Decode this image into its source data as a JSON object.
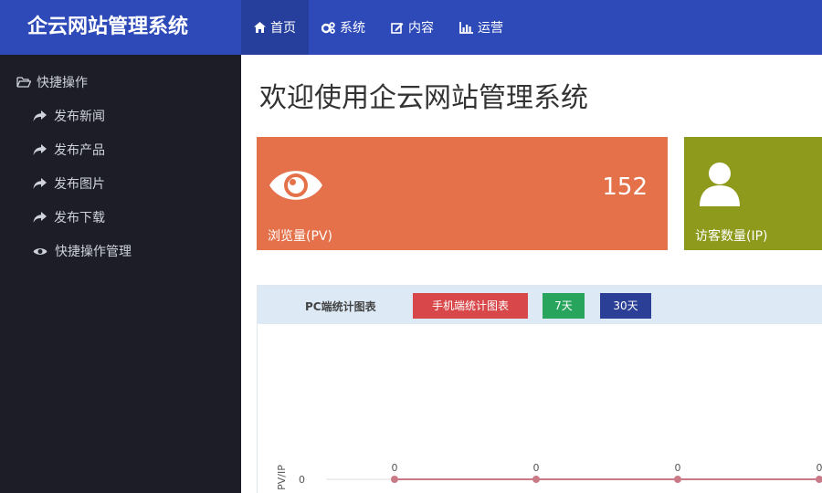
{
  "header": {
    "brand": "企云网站管理系统",
    "nav": [
      {
        "label": "首页",
        "icon": "home-icon",
        "active": true
      },
      {
        "label": "系统",
        "icon": "cogs-icon",
        "active": false
      },
      {
        "label": "内容",
        "icon": "edit-icon",
        "active": false
      },
      {
        "label": "运营",
        "icon": "bar-chart-icon",
        "active": false
      }
    ]
  },
  "sidebar": {
    "group_label": "快捷操作",
    "items": [
      {
        "label": "发布新闻",
        "icon": "share-icon"
      },
      {
        "label": "发布产品",
        "icon": "share-icon"
      },
      {
        "label": "发布图片",
        "icon": "share-icon"
      },
      {
        "label": "发布下载",
        "icon": "share-icon"
      },
      {
        "label": "快捷操作管理",
        "icon": "eye-icon"
      }
    ]
  },
  "main": {
    "title": "欢迎使用企云网站管理系统",
    "cards": [
      {
        "label": "浏览量(PV)",
        "value": "152",
        "icon": "eye-icon",
        "color": "#e4714a"
      },
      {
        "label": "访客数量(IP)",
        "value": "",
        "icon": "user-icon",
        "color": "#8d9a1c"
      }
    ],
    "chart_tabs": {
      "pc": "PC端统计图表",
      "mobile": "手机端统计图表",
      "days7": "7天",
      "days30": "30天"
    }
  },
  "chart_data": {
    "type": "line",
    "ylabel": "PV/IP",
    "y_ticks": [
      "0"
    ],
    "series": [
      {
        "color": "#c97a86",
        "values": [
          0,
          0,
          0,
          0,
          0
        ],
        "data_labels": [
          "0",
          "0",
          "0",
          "0",
          "0"
        ]
      }
    ]
  }
}
